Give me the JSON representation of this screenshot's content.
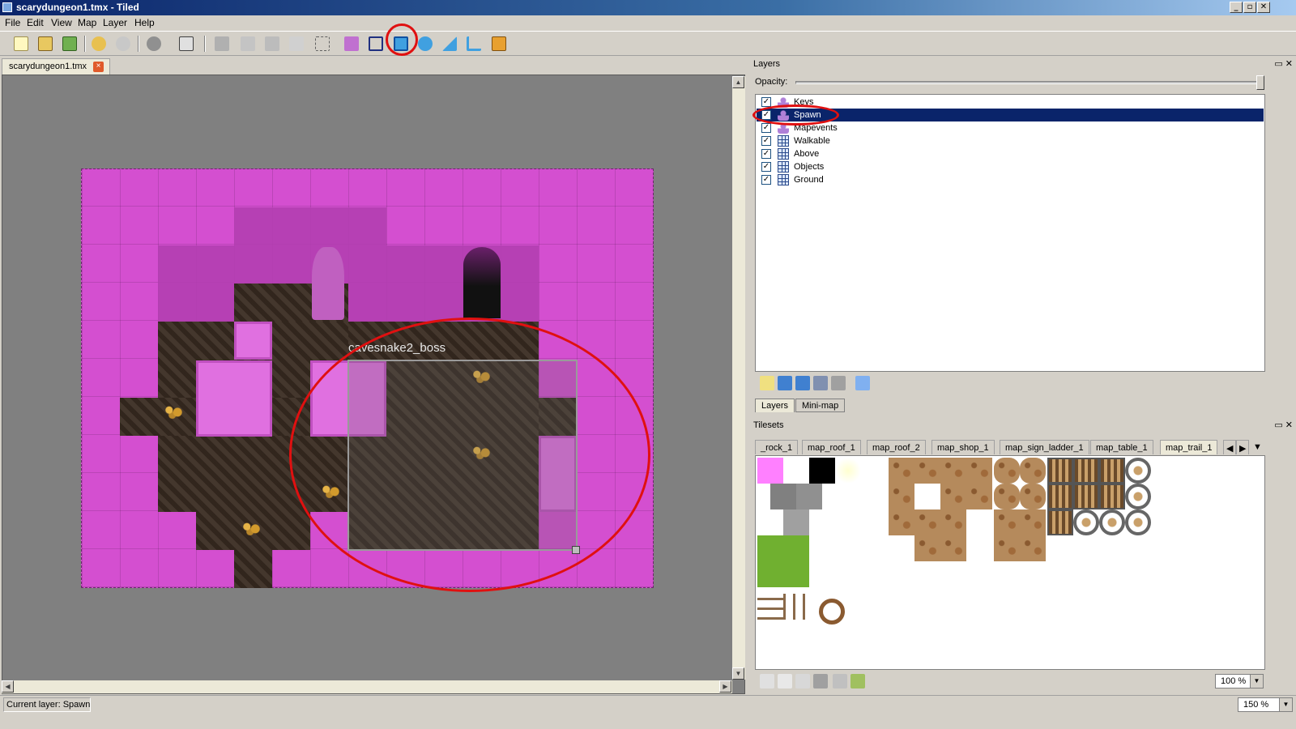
{
  "window": {
    "title": "scarydungeon1.tmx - Tiled",
    "minimize": "_",
    "maximize": "▫",
    "close": "✕"
  },
  "menu": [
    "File",
    "Edit",
    "View",
    "Map",
    "Layer",
    "Help"
  ],
  "toolbar": {
    "icons": [
      "new-icon",
      "open-icon",
      "save-icon",
      "undo-icon",
      "redo-icon",
      "commands-icon",
      "random-icon",
      "stamp-brush-icon",
      "terrain-brush-icon",
      "bucket-fill-icon",
      "eraser-icon",
      "rectangle-select-icon",
      "select-objects-icon",
      "edit-polygons-icon",
      "insert-rectangle-icon",
      "insert-ellipse-icon",
      "insert-polygon-icon",
      "insert-polyline-icon",
      "insert-tile-icon"
    ],
    "accent_ring": "#e01010"
  },
  "document_tab": {
    "label": "scarydungeon1.tmx",
    "close": "×"
  },
  "map": {
    "object_name": "cavesnake2_boss",
    "colors": {
      "base": "#d44fd0",
      "floor": "#3a2c22",
      "highlight_ring": "#e01010"
    }
  },
  "layers_panel": {
    "title": "Layers",
    "dock_buttons": "▭ ✕",
    "opacity_label": "Opacity:",
    "layers": [
      {
        "name": "Keys",
        "type": "object",
        "visible": true,
        "selected": false
      },
      {
        "name": "Spawn",
        "type": "object",
        "visible": true,
        "selected": true
      },
      {
        "name": "Mapevents",
        "type": "object",
        "visible": true,
        "selected": false
      },
      {
        "name": "Walkable",
        "type": "tile",
        "visible": true,
        "selected": false
      },
      {
        "name": "Above",
        "type": "tile",
        "visible": true,
        "selected": false
      },
      {
        "name": "Objects",
        "type": "tile",
        "visible": true,
        "selected": false
      },
      {
        "name": "Ground",
        "type": "tile",
        "visible": true,
        "selected": false
      }
    ],
    "check": "✓",
    "tabs": [
      "Layers",
      "Mini-map"
    ]
  },
  "tilesets_panel": {
    "title": "Tilesets",
    "dock_buttons": "▭ ✕",
    "tabs": [
      "_rock_1",
      "map_roof_1",
      "map_roof_2",
      "map_shop_1",
      "map_sign_ladder_1",
      "map_table_1",
      "map_trail_1"
    ],
    "active_tab": "map_trail_1",
    "nav": [
      "◀",
      "▶",
      "▼"
    ],
    "zoom": "100 %"
  },
  "status": {
    "current_layer": "Current layer: Spawn",
    "zoom": "150 %"
  },
  "scroll": {
    "up": "▲",
    "down": "▼",
    "left": "◀",
    "right": "▶"
  }
}
